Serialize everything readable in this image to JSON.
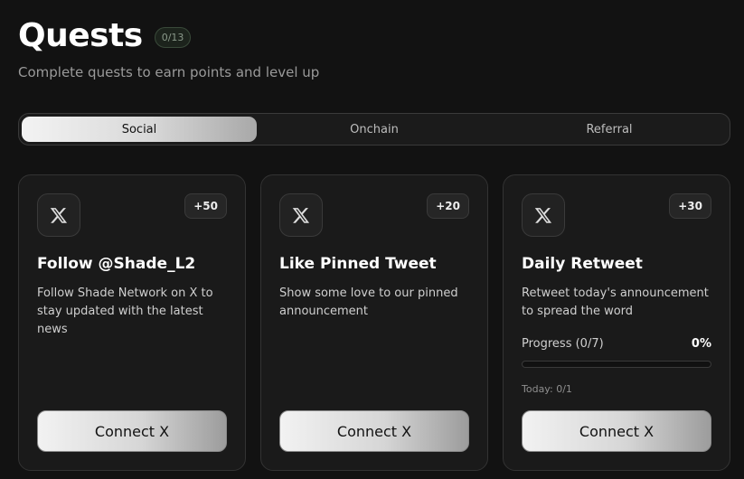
{
  "header": {
    "title": "Quests",
    "count_badge": "0/13",
    "subtitle": "Complete quests to earn points and level up"
  },
  "tabs": [
    {
      "label": "Social",
      "active": true
    },
    {
      "label": "Onchain",
      "active": false
    },
    {
      "label": "Referral",
      "active": false
    }
  ],
  "cards": [
    {
      "icon": "x-logo-icon",
      "points": "+50",
      "title": "Follow @Shade_L2",
      "description": "Follow Shade Network on X to stay updated with the latest news",
      "button_label": "Connect X"
    },
    {
      "icon": "x-logo-icon",
      "points": "+20",
      "title": "Like Pinned Tweet",
      "description": "Show some love to our pinned announcement",
      "button_label": "Connect X"
    },
    {
      "icon": "x-logo-icon",
      "points": "+30",
      "title": "Daily Retweet",
      "description": "Retweet today's announcement to spread the word",
      "progress": {
        "label": "Progress (0/7)",
        "percent_text": "0%",
        "fraction": 0,
        "today": "Today: 0/1"
      },
      "button_label": "Connect X"
    }
  ],
  "colors": {
    "background": "#121212",
    "card_bg": "#1a1a1a",
    "badge_border": "#3a4a3a"
  }
}
